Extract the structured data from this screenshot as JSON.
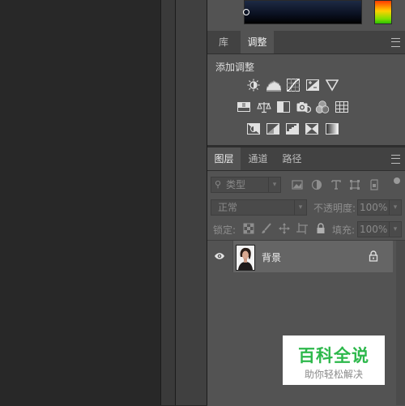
{
  "upper_tabs": {
    "library": "库",
    "adjustments": "调整"
  },
  "adjustments": {
    "heading": "添加调整",
    "row1_icons": [
      "brightness-contrast-icon",
      "levels-icon",
      "curves-icon",
      "exposure-icon",
      "vibrance-icon"
    ],
    "row2_icons": [
      "hue-saturation-icon",
      "color-balance-icon",
      "black-white-icon",
      "photo-filter-icon",
      "channel-mixer-icon",
      "color-lookup-icon"
    ],
    "row3_icons": [
      "invert-icon",
      "posterize-icon",
      "threshold-icon",
      "selective-color-icon",
      "gradient-map-icon"
    ]
  },
  "layers_tabs": {
    "layers": "图层",
    "channels": "通道",
    "paths": "路径"
  },
  "filter": {
    "placeholder": "类型"
  },
  "blend": {
    "mode": "正常",
    "opacity_label": "不透明度:",
    "opacity_value": "100%"
  },
  "lock": {
    "label": "锁定:",
    "fill_label": "填充:",
    "fill_value": "100%"
  },
  "layer": {
    "name": "背景"
  },
  "watermark": {
    "title": "百科全说",
    "subtitle": "助你轻松解决"
  },
  "colors": {
    "panel_bg": "#535353",
    "tab_bar": "#424242",
    "selected_layer": "#656565",
    "watermark_green": "#2db84b"
  }
}
